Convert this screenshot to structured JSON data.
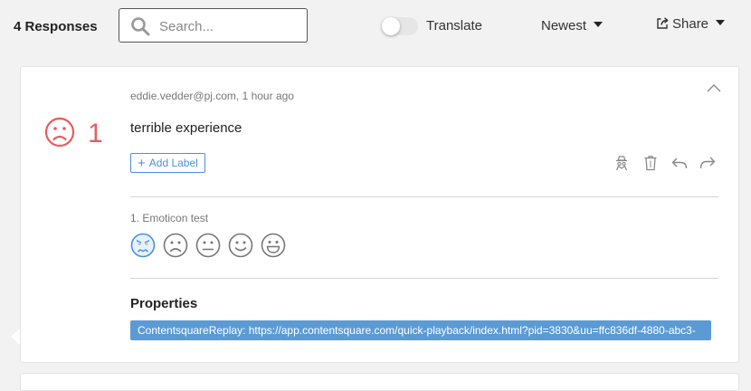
{
  "header": {
    "responses_count": "4 Responses",
    "search": {
      "placeholder": "Search...",
      "value": "",
      "icon": "search-icon"
    },
    "translate": {
      "label": "Translate",
      "enabled": false
    },
    "sort": {
      "label": "Newest",
      "icon": "caret-down-icon"
    },
    "share": {
      "label": "Share",
      "icon": "share-icon"
    }
  },
  "response": {
    "score": "1",
    "score_icon": "sad-face-icon",
    "score_color": "#e85c5c",
    "meta": "eddie.vedder@pj.com, 1 hour ago",
    "text": "terrible experience",
    "add_label": "Add Label",
    "actions": [
      "anonymize-icon",
      "trash-icon",
      "reply-icon",
      "forward-icon"
    ],
    "question": {
      "label": "1. Emoticon test",
      "options": [
        "angry-face-icon",
        "sad-face-icon",
        "neutral-face-icon",
        "smile-face-icon",
        "grin-face-icon"
      ],
      "selected_index": 0
    },
    "properties": {
      "title": "Properties",
      "items": [
        "ContentsquareReplay: https://app.contentsquare.com/quick-playback/index.html?pid=3830&uu=ffc836df-4880-abc3-"
      ]
    }
  },
  "colors": {
    "accent": "#4a90e2",
    "chip": "#5b9bd5",
    "negative": "#e85c5c",
    "background": "#f2f2f2"
  }
}
